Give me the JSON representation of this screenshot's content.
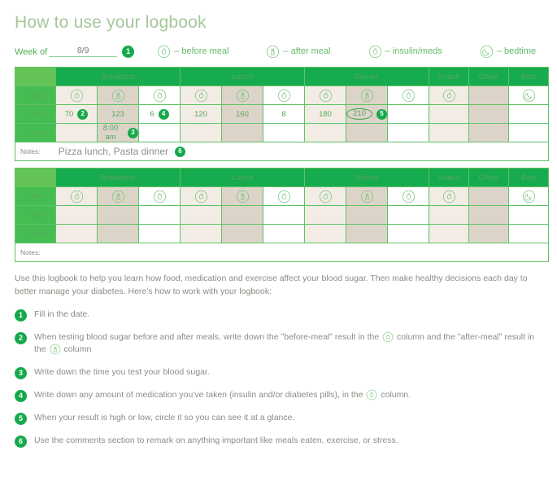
{
  "page": {
    "title": "How to use your logbook",
    "week_of_label": "Week of",
    "week_of_value": "8/9",
    "week_of_badge": "1"
  },
  "colors": {
    "header_green": "#16ab4e",
    "row_label_green": "#46bd52",
    "corner_green": "#63c356",
    "badge_green": "#16a94b",
    "cell_light": "#f3ece5",
    "cell_dark": "#ddd4c9",
    "title_color": "#a7c69a",
    "body_text": "#8c8c85"
  },
  "legend": [
    {
      "icon": "before-meal-icon",
      "label": "– before meal"
    },
    {
      "icon": "after-meal-icon",
      "label": "– after meal"
    },
    {
      "icon": "insulin-meds-icon",
      "label": "– insulin/meds"
    },
    {
      "icon": "bedtime-icon",
      "label": "– bedtime"
    }
  ],
  "table": {
    "meal_headers": [
      "Breakfast",
      "Lunch",
      "Dinner"
    ],
    "extra_headers": [
      "Snack",
      "Other",
      "Bed"
    ],
    "row_labels": {
      "day": "Day",
      "mon": "Mon",
      "time": "Time",
      "notes": "Notes:"
    },
    "icon_row": [
      "before-meal-icon",
      "after-meal-icon",
      "insulin-meds-icon",
      "before-meal-icon",
      "after-meal-icon",
      "insulin-meds-icon",
      "before-meal-icon",
      "after-meal-icon",
      "insulin-meds-icon",
      "before-meal-icon",
      "",
      "bedtime-icon"
    ]
  },
  "filled_table": {
    "mon_values": [
      "70",
      "123",
      "6",
      "120",
      "160",
      "8",
      "180",
      "210",
      "",
      "",
      "",
      ""
    ],
    "mon_badges": [
      "2",
      "",
      "4",
      "",
      "",
      "",
      "",
      "5",
      "",
      "",
      "",
      ""
    ],
    "mon_circled": [
      false,
      false,
      false,
      false,
      false,
      false,
      false,
      true,
      false,
      false,
      false,
      false
    ],
    "time_values": [
      "",
      "8:00 am",
      "",
      "",
      "",
      "",
      "",
      "",
      "",
      "",
      "",
      ""
    ],
    "time_badges": [
      "",
      "3",
      "",
      "",
      "",
      "",
      "",
      "",
      "",
      "",
      "",
      ""
    ],
    "notes_value": "Pizza lunch, Pasta dinner",
    "notes_badge": "6"
  },
  "empty_table": {
    "mon_values": [
      "",
      "",
      "",
      "",
      "",
      "",
      "",
      "",
      "",
      "",
      "",
      ""
    ],
    "time_values": [
      "",
      "",
      "",
      "",
      "",
      "",
      "",
      "",
      "",
      "",
      "",
      ""
    ],
    "notes_value": ""
  },
  "intro": "Use this logbook to help you learn how food, medication and exercise affect your blood sugar. Then make healthy decisions each day to better manage your diabetes. Here's how to work with your logbook:",
  "steps": [
    {
      "num": "1",
      "parts": [
        {
          "t": "Fill in the date."
        }
      ]
    },
    {
      "num": "2",
      "parts": [
        {
          "t": "When testing blood sugar before and after meals, write down the ʺbefore-mealʺ result in the "
        },
        {
          "icon": "before-meal-icon"
        },
        {
          "t": " column and the ʺafter-mealʺ result in the "
        },
        {
          "icon": "after-meal-icon"
        },
        {
          "t": " column"
        }
      ]
    },
    {
      "num": "3",
      "parts": [
        {
          "t": " Write down the time you test your blood sugar."
        }
      ]
    },
    {
      "num": "4",
      "parts": [
        {
          "t": "Write down any amount of medication you've taken (insulin and/or diabetes pills), in the "
        },
        {
          "icon": "insulin-meds-icon"
        },
        {
          "t": " column."
        }
      ]
    },
    {
      "num": "5",
      "parts": [
        {
          "t": "When your result is high or low, circle it so you can see it at a glance."
        }
      ]
    },
    {
      "num": "6",
      "parts": [
        {
          "t": "Use the comments section to remark on anything important like meals eaten, exercise, or stress."
        }
      ]
    }
  ]
}
